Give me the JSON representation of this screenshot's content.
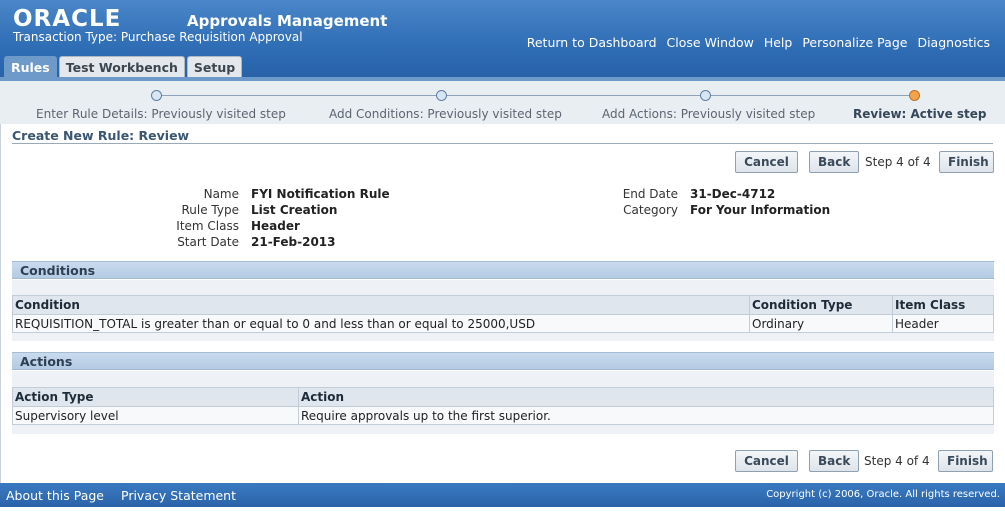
{
  "header": {
    "logo": "ORACLE",
    "app_title": "Approvals Management",
    "transaction_type": "Transaction Type: Purchase Requisition Approval",
    "links": [
      "Return to Dashboard",
      "Close Window",
      "Help",
      "Personalize Page",
      "Diagnostics"
    ]
  },
  "tabs": [
    {
      "label": "Rules",
      "active": true
    },
    {
      "label": "Test Workbench",
      "active": false
    },
    {
      "label": "Setup",
      "active": false
    }
  ],
  "train": {
    "steps": [
      {
        "label": "Enter Rule Details: Previously visited step",
        "active": false
      },
      {
        "label": "Add Conditions: Previously visited step",
        "active": false
      },
      {
        "label": "Add Actions: Previously visited step",
        "active": false
      },
      {
        "label": "Review: Active step",
        "active": true
      }
    ]
  },
  "page_title": "Create New Rule: Review",
  "nav": {
    "cancel": "Cancel",
    "back": "Back",
    "step": "Step 4 of 4",
    "finish": "Finish"
  },
  "fields": {
    "name_label": "Name",
    "name_value": "FYI Notification Rule",
    "rule_type_label": "Rule Type",
    "rule_type_value": "List Creation",
    "item_class_label": "Item Class",
    "item_class_value": "Header",
    "start_date_label": "Start Date",
    "start_date_value": "21-Feb-2013",
    "end_date_label": "End Date",
    "end_date_value": "31-Dec-4712",
    "category_label": "Category",
    "category_value": "For Your Information"
  },
  "conditions": {
    "title": "Conditions",
    "headers": [
      "Condition",
      "Condition Type",
      "Item Class"
    ],
    "rows": [
      [
        "REQUISITION_TOTAL is greater than or equal to 0 and less than or equal to 25000,USD",
        "Ordinary",
        "Header"
      ]
    ]
  },
  "actions": {
    "title": "Actions",
    "headers": [
      "Action Type",
      "Action"
    ],
    "rows": [
      [
        "Supervisory level",
        "Require approvals up to the first superior."
      ]
    ]
  },
  "footer": {
    "about": "About this Page",
    "privacy": "Privacy Statement",
    "copyright": "Copyright (c) 2006, Oracle. All rights reserved."
  }
}
